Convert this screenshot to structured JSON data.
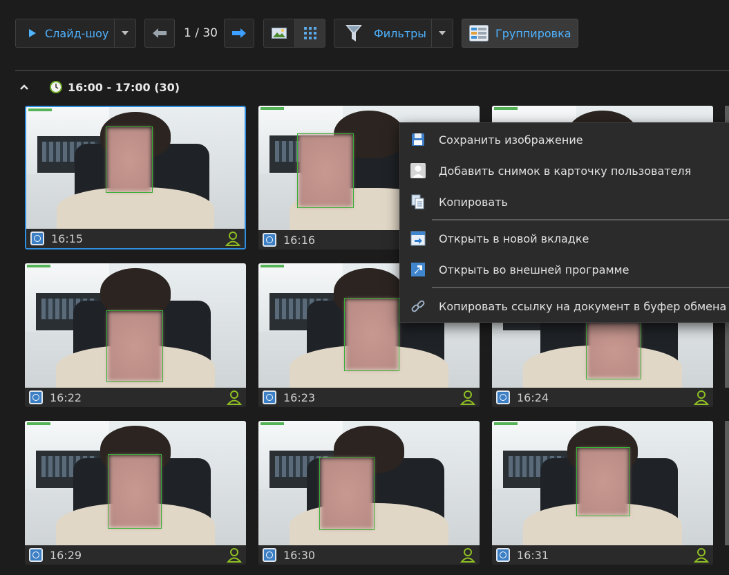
{
  "toolbar": {
    "slideshow_label": "Слайд-шоу",
    "page_counter": "1 / 30",
    "filters_label": "Фильтры",
    "grouping_label": "Группировка"
  },
  "group": {
    "label": "16:00 - 17:00 (30)"
  },
  "thumbnails": [
    {
      "time": "16:15",
      "selected": true
    },
    {
      "time": "16:16"
    },
    {
      "time": "16:22"
    },
    {
      "time": "16:23"
    },
    {
      "time": "16:24"
    },
    {
      "time": "16:29"
    },
    {
      "time": "16:30"
    },
    {
      "time": "16:31"
    }
  ],
  "context_menu": {
    "items": [
      {
        "label": "Сохранить изображение",
        "icon": "save-icon"
      },
      {
        "label": "Добавить снимок в карточку пользователя",
        "icon": "user-card-icon"
      },
      {
        "label": "Копировать",
        "icon": "copy-icon"
      },
      {
        "label": "Открыть в новой вкладке",
        "icon": "new-tab-icon"
      },
      {
        "label": "Открыть во внешней программе",
        "icon": "external-open-icon"
      },
      {
        "label": "Копировать ссылку на документ в буфер обмена",
        "icon": "link-icon"
      }
    ]
  },
  "colors": {
    "accent_blue": "#4fb3ff",
    "selection_border": "#2f8fe0",
    "user_icon_green": "#8fbf22",
    "face_box_green": "#37b037"
  }
}
